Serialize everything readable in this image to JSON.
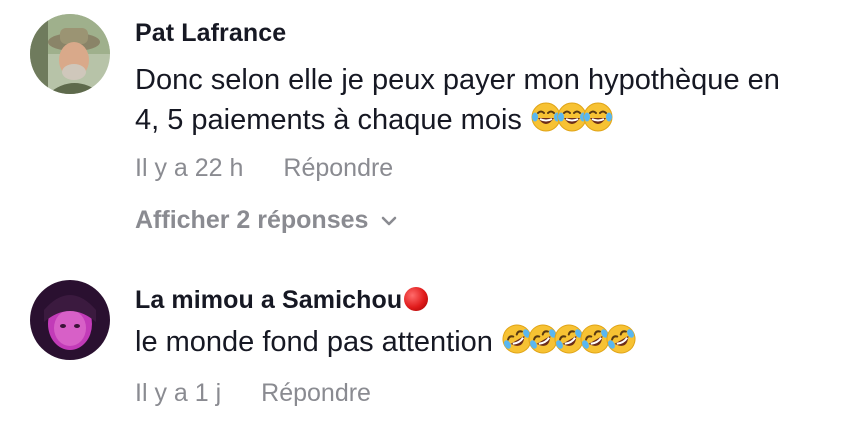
{
  "comments": [
    {
      "author": "Pat Lafrance",
      "text": "Donc selon elle je peux payer mon hypothèque en\n4, 5 paiements à chaque mois",
      "emoji_count": 3,
      "emoji_name": "face-with-tears-of-joy-icon",
      "time": "Il y a 22 h",
      "reply_label": "Répondre",
      "view_replies": "Afficher 2 réponses"
    },
    {
      "author": "La mimou a Samichou",
      "author_badge": "red-circle-icon",
      "text": "le monde fond pas attention",
      "emoji_count": 5,
      "emoji_name": "rolling-on-the-floor-laughing-icon",
      "time": "Il y a 1 j",
      "reply_label": "Répondre"
    }
  ],
  "colors": {
    "text": "#161823",
    "muted": "#8a8b91",
    "emoji_yellow": "#f7c233",
    "badge_red": "#e01b1b"
  }
}
